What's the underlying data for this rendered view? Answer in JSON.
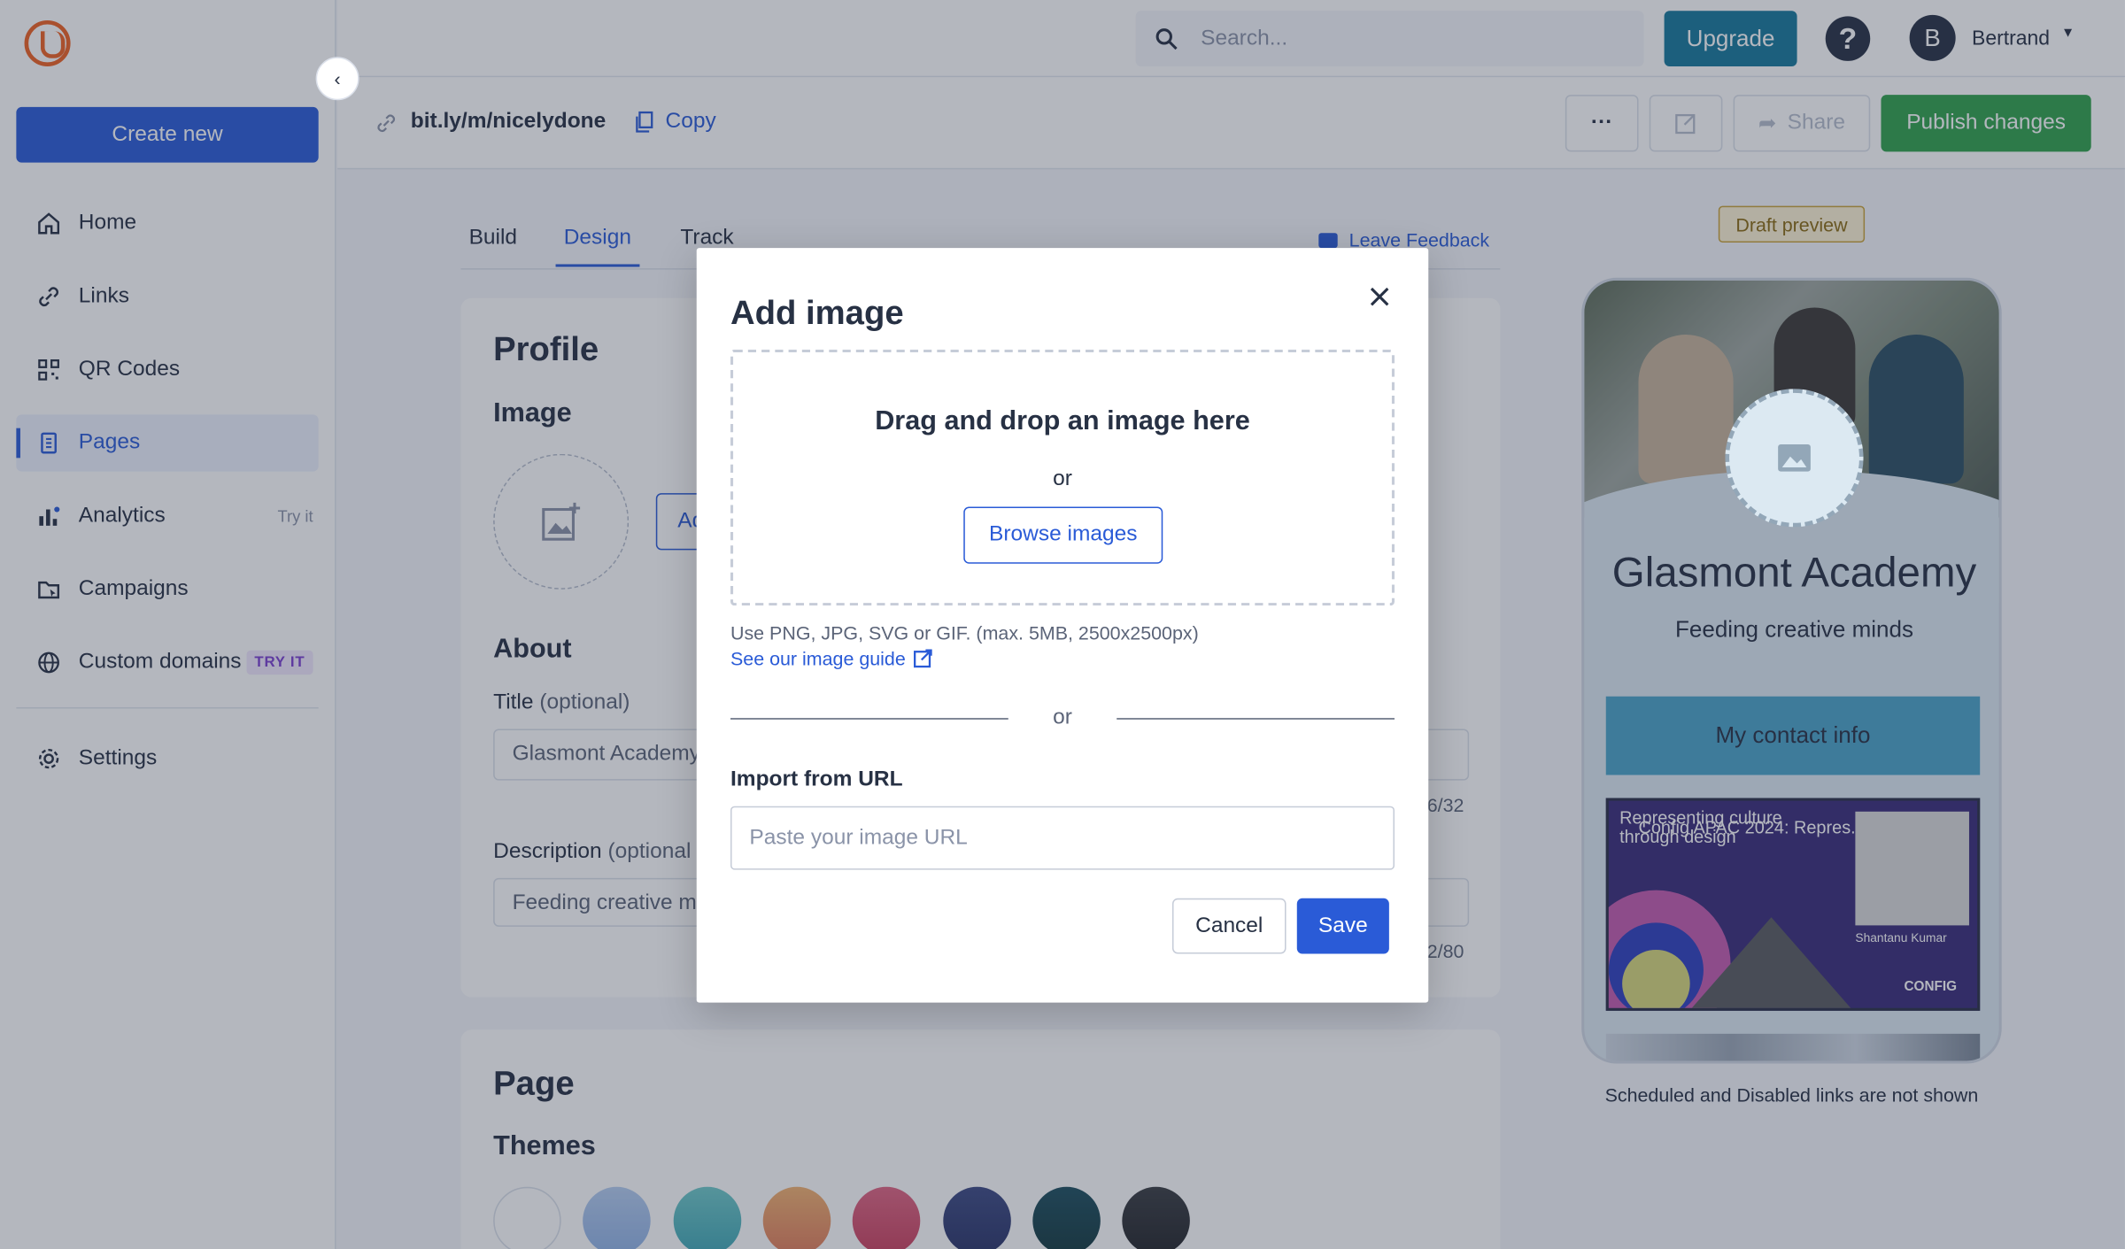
{
  "sidebar": {
    "create_label": "Create new",
    "items": [
      {
        "label": "Home",
        "icon": "home-icon"
      },
      {
        "label": "Links",
        "icon": "link-icon"
      },
      {
        "label": "QR Codes",
        "icon": "qr-code-icon"
      },
      {
        "label": "Pages",
        "icon": "page-icon",
        "active": true
      },
      {
        "label": "Analytics",
        "icon": "analytics-icon",
        "badge": "Try it"
      },
      {
        "label": "Campaigns",
        "icon": "campaigns-icon"
      },
      {
        "label": "Custom domains",
        "icon": "globe-icon",
        "badge": "TRY IT"
      },
      {
        "label": "Settings",
        "icon": "gear-icon"
      }
    ]
  },
  "header": {
    "search_placeholder": "Search...",
    "upgrade_label": "Upgrade",
    "help_label": "?",
    "avatar_initial": "B",
    "user_name": "Bertrand"
  },
  "toolbar": {
    "short_link": "bit.ly/m/nicelydone",
    "copy_label": "Copy",
    "more_label": "···",
    "share_label": "Share",
    "publish_label": "Publish changes"
  },
  "tabs": [
    {
      "label": "Build"
    },
    {
      "label": "Design",
      "active": true
    },
    {
      "label": "Track"
    }
  ],
  "feedback_label": "Leave Feedback",
  "profile": {
    "heading": "Profile",
    "image_heading": "Image",
    "add_button_partial": "Ad",
    "about_heading": "About",
    "title_label": "Title",
    "title_optional": "(optional)",
    "title_value": "Glasmont Academy",
    "title_counter": "6/32",
    "description_label": "Description",
    "description_optional": "(optional",
    "description_value": "Feeding creative m",
    "description_counter": "2/80"
  },
  "page_section": {
    "heading": "Page",
    "themes_heading": "Themes",
    "theme_colors": [
      "#ffffff",
      "#b5cdf0",
      "#6fc9c9",
      "#f2b270",
      "#e06583",
      "#3d4a84",
      "#1e4f5f",
      "#3a3d42"
    ]
  },
  "preview": {
    "draft_label": "Draft preview",
    "title": "Glasmont Academy",
    "description": "Feeding creative minds",
    "contact_label": "My contact info",
    "promo_text_back": "Representing culture through design",
    "promo_text_front": "Config APAC 2024: Repres...",
    "promo_person": "Shantanu Kumar",
    "promo_logo": "CONFIG",
    "note": "Scheduled and Disabled links are not shown"
  },
  "dialog": {
    "title": "Add image",
    "dropzone_title": "Drag and drop an image here",
    "dropzone_or": "or",
    "browse_label": "Browse images",
    "hint": "Use PNG, JPG, SVG or GIF. (max. 5MB, 2500x2500px)",
    "guide_label": "See our image guide",
    "or_label": "or",
    "import_label": "Import from URL",
    "url_placeholder": "Paste your image URL",
    "url_value": "",
    "cancel_label": "Cancel",
    "save_label": "Save"
  },
  "colors": {
    "primary": "#2a5bd7",
    "upgrade": "#16799b",
    "publish": "#31a24c",
    "text": "#273144"
  }
}
